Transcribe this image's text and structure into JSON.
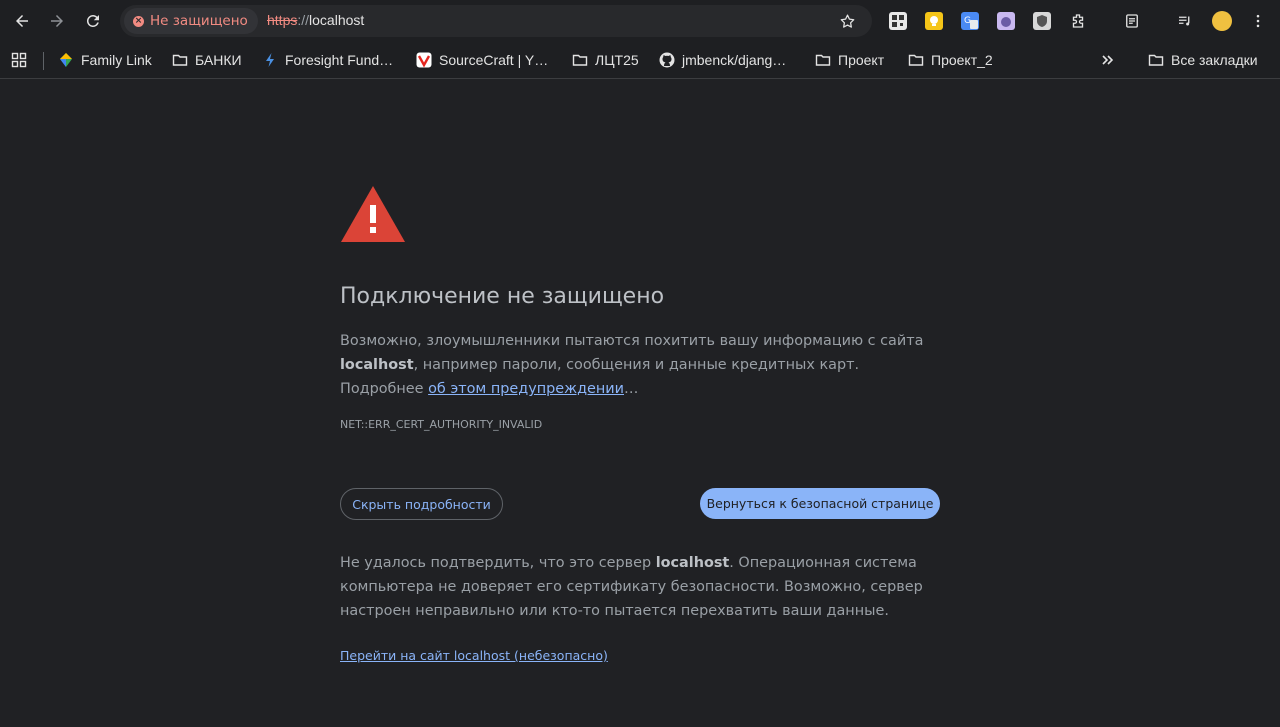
{
  "toolbar": {
    "security_chip_label": "Не защищено",
    "url_scheme": "https",
    "url_separator": "://",
    "url_host": "localhost"
  },
  "bookmarks": [
    {
      "label": "Family Link",
      "icon": "family-link-icon"
    },
    {
      "label": "БАНКИ",
      "icon": "folder-icon"
    },
    {
      "label": "Foresight Fund…",
      "icon": "lightning-icon"
    },
    {
      "label": "SourceCraft | Y…",
      "icon": "sourcecraft-icon"
    },
    {
      "label": "ЛЦТ25",
      "icon": "folder-icon"
    },
    {
      "label": "jmbenck/djang…",
      "icon": "github-icon"
    },
    {
      "label": "Проект",
      "icon": "folder-icon"
    },
    {
      "label": "Проект_2",
      "icon": "folder-icon"
    }
  ],
  "all_bookmarks_label": "Все закладки",
  "interstitial": {
    "headline": "Подключение не защищено",
    "desc_part1": "Возможно, злоумышленники пытаются похитить вашу информацию с сайта ",
    "desc_host": "localhost",
    "desc_part2": ", например пароли, сообщения и данные кредитных карт. Подробнее ",
    "desc_link": "об этом предупреждении",
    "desc_ellipsis": "…",
    "error_code": "NET::ERR_CERT_AUTHORITY_INVALID",
    "hide_details_button": "Скрыть подробности",
    "back_button": "Вернуться к безопасной странице",
    "details_part1": "Не удалось подтвердить, что это сервер ",
    "details_host": "localhost",
    "details_part2": ". Операционная система компьютера не доверяет его сертификату безопасности. Возможно, сервер настроен неправильно или кто-то пытается перехватить ваши данные.",
    "proceed_link": "Перейти на сайт localhost (небезопасно)"
  },
  "colors": {
    "background": "#202124",
    "accent_blue": "#8ab4f8",
    "warning_red": "#db4437",
    "insecure_red": "#f28b82"
  }
}
